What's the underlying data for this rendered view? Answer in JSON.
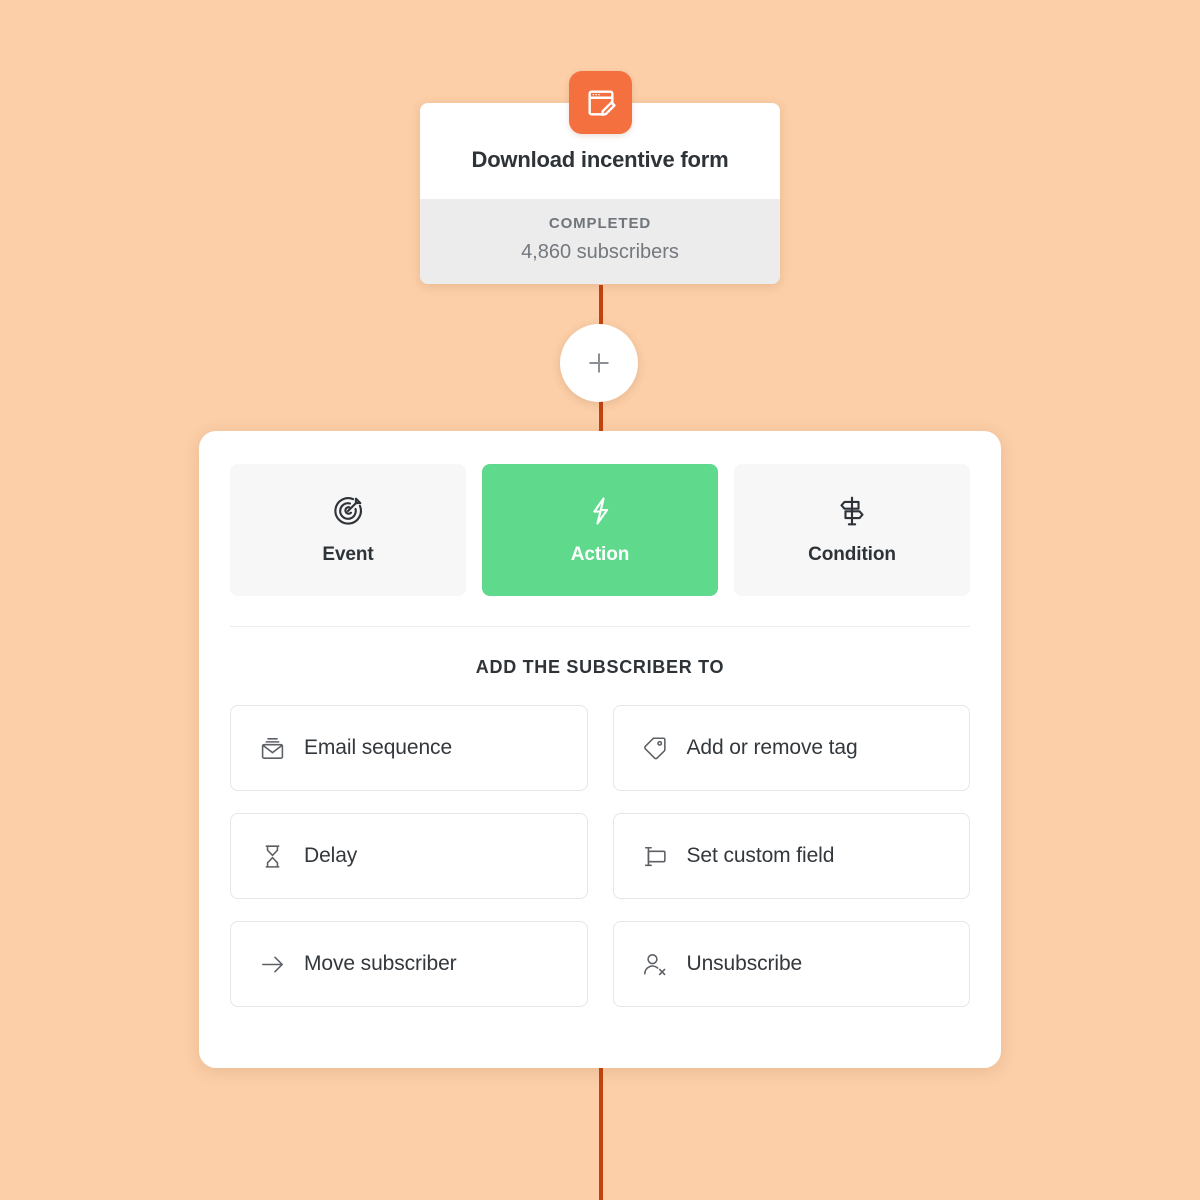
{
  "theme": {
    "background": "#fccfa8",
    "connector_line": "#c2430f",
    "accent_orange": "#f4703e",
    "accent_green": "#5fd98c",
    "card_background": "#ffffff",
    "footer_background": "#ececec",
    "tab_inactive_background": "#f7f7f7",
    "text_primary": "#2e3338",
    "text_muted": "#73797e"
  },
  "trigger_node": {
    "icon": "form-edit-icon",
    "title": "Download incentive form",
    "status": "COMPLETED",
    "count": "4,860 subscribers"
  },
  "add_step_button": {
    "icon": "plus-icon",
    "label": "+"
  },
  "picker": {
    "tabs": [
      {
        "label": "Event",
        "icon": "target-icon",
        "selected": false
      },
      {
        "label": "Action",
        "icon": "lightning-bolt-icon",
        "selected": true
      },
      {
        "label": "Condition",
        "icon": "signpost-icon",
        "selected": false
      }
    ],
    "section_title": "ADD THE SUBSCRIBER TO",
    "options": [
      {
        "label": "Email sequence",
        "icon": "email-sequence-icon"
      },
      {
        "label": "Add or remove tag",
        "icon": "tag-icon"
      },
      {
        "label": "Delay",
        "icon": "hourglass-icon"
      },
      {
        "label": "Set custom field",
        "icon": "custom-field-icon"
      },
      {
        "label": "Move subscriber",
        "icon": "arrow-right-icon"
      },
      {
        "label": "Unsubscribe",
        "icon": "user-remove-icon"
      }
    ]
  }
}
